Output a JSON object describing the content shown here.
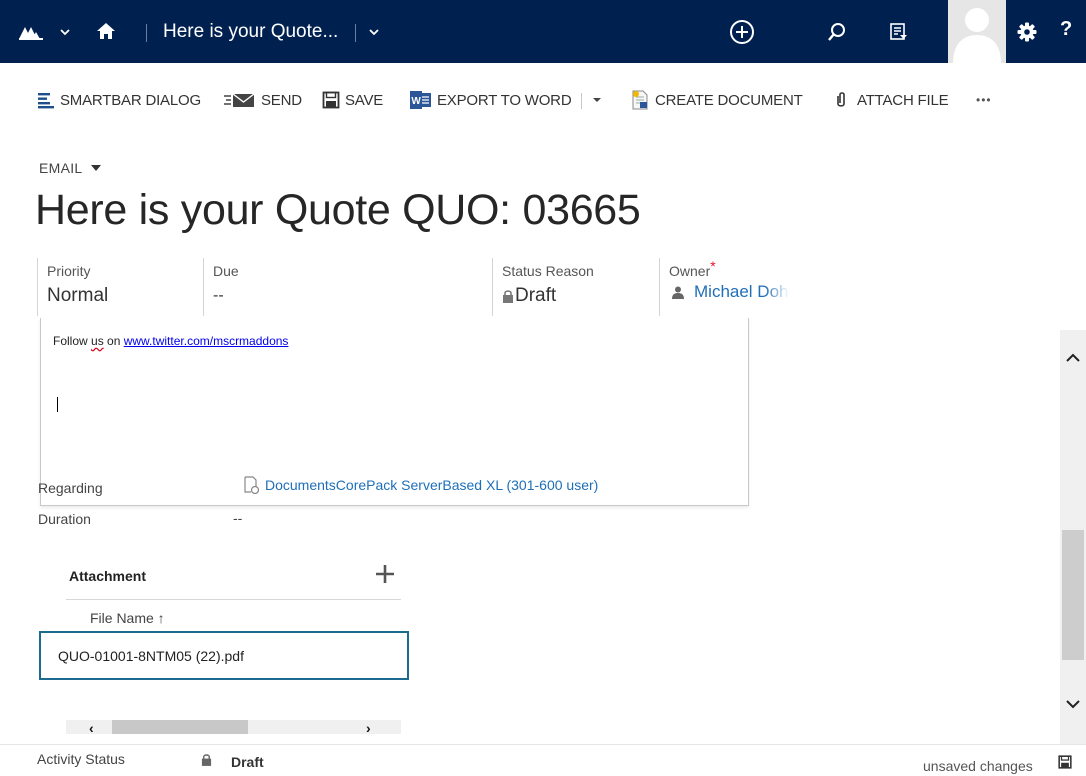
{
  "colors": {
    "navbar": "#002050",
    "link": "#1f6fb8",
    "required": "#e81123",
    "focus": "#1b6a8f"
  },
  "navbar": {
    "title": "Here is your Quote...",
    "icons": [
      "dynamics-logo-icon",
      "chevron-down-icon",
      "home-icon",
      "plus-circle-icon",
      "search-icon",
      "advanced-find-icon",
      "user-avatar",
      "gear-icon",
      "help-icon"
    ],
    "help": "?"
  },
  "commands": {
    "smartbar": "SMARTBAR DIALOG",
    "send": "SEND",
    "save": "SAVE",
    "export": "EXPORT TO WORD",
    "create": "CREATE DOCUMENT",
    "attach": "ATTACH FILE",
    "more": "•••"
  },
  "header": {
    "entity": "EMAIL",
    "title": "Here is your Quote QUO: 03665",
    "fields": [
      {
        "label": "Priority",
        "value": "Normal"
      },
      {
        "label": "Due",
        "value": "--"
      },
      {
        "label": "Status Reason",
        "value": "Draft"
      },
      {
        "label": "Owner",
        "value": "Michael Doh",
        "required": "*"
      }
    ]
  },
  "body": {
    "follow_prefix": "Follow ",
    "follow_us": "us",
    "follow_on": " on ",
    "follow_link": "www.twitter.com/mscrmaddons"
  },
  "form": {
    "regarding_label": "Regarding",
    "regarding_value": "DocumentsCorePack ServerBased XL (301-600 user)",
    "duration_label": "Duration",
    "duration_value": "--"
  },
  "attachments": {
    "title": "Attachment",
    "column": "File Name ↑",
    "rows": [
      "QUO-01001-8NTM05 (22).pdf"
    ]
  },
  "footer": {
    "status_label": "Activity Status",
    "status_value": "Draft",
    "unsaved": "unsaved changes"
  }
}
